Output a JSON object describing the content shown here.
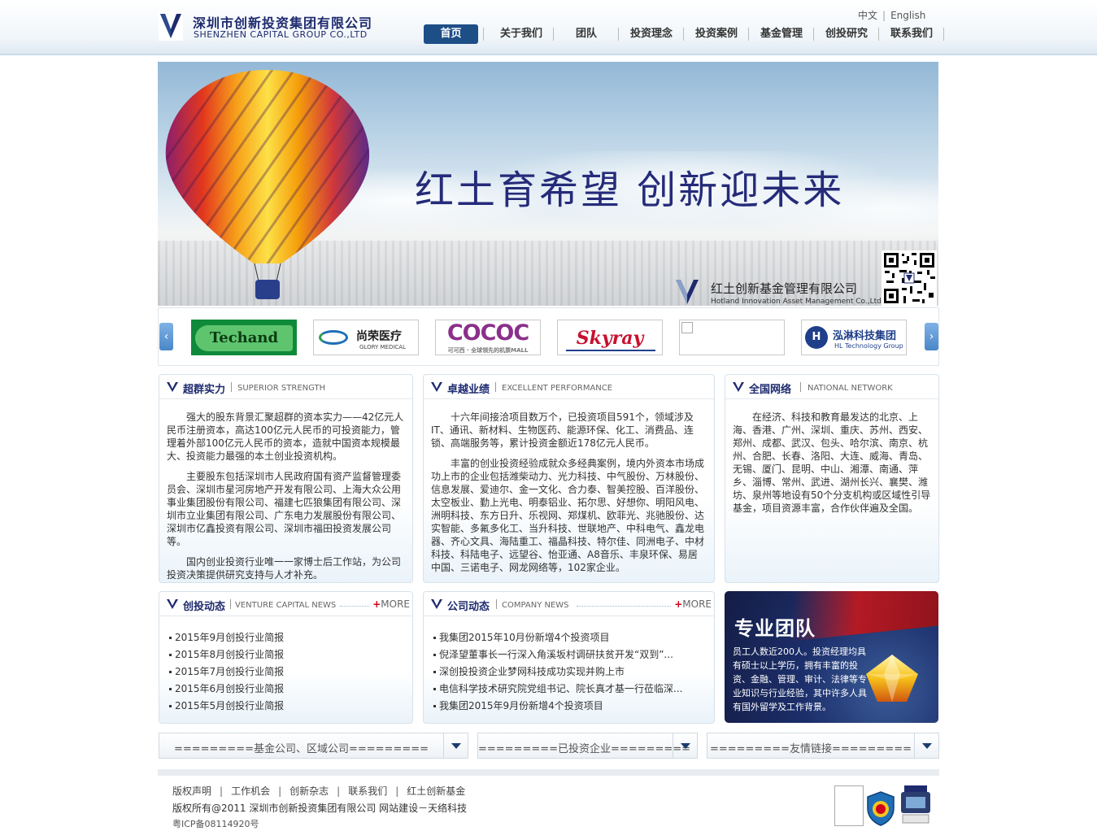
{
  "header": {
    "logo_cn": "深圳市创新投资集团有限公司",
    "logo_en": "SHENZHEN CAPITAL GROUP CO.,LTD",
    "lang_cn": "中文",
    "lang_sep": "|",
    "lang_en": "English",
    "nav": [
      "首页",
      "关于我们",
      "团队",
      "投资理念",
      "投资案例",
      "基金管理",
      "创投研究",
      "联系我们"
    ]
  },
  "banner": {
    "slogan": "红土育希望  创新迎未来",
    "fund_name": "红土创新基金管理有限公司",
    "fund_en": "Hotland Innovation Asset Management Co.,Ltd"
  },
  "partners": {
    "prev": "‹",
    "next": "›",
    "items": [
      {
        "name": "Techand",
        "text": "Techand"
      },
      {
        "name": "Glory Medical",
        "text": "尚荣医疗",
        "sub": "GLORY MEDICAL"
      },
      {
        "name": "COCOC",
        "text": "COCOC",
        "sub": "可可西 · 全球领先的机票MALL"
      },
      {
        "name": "Skyray",
        "text": "Skyray"
      },
      {
        "name": "empty",
        "text": ""
      },
      {
        "name": "HL Technology",
        "text": "泓淋科技集团",
        "sub": "HL Technology Group"
      }
    ]
  },
  "panels": {
    "strength": {
      "title": "超群实力",
      "en": "SUPERIOR STRENGTH",
      "paragraphs": [
        "强大的股东背景汇聚超群的资本实力——42亿元人民币注册资本，高达100亿元人民币的可投资能力，管理着外部100亿元人民币的资本，造就中国资本规模最大、投资能力最强的本土创业投资机构。",
        "主要股东包括深圳市人民政府国有资产监督管理委员会、深圳市星河房地产开发有限公司、上海大众公用事业集团股份有限公司、福建七匹狼集团有限公司、深圳市立业集团有限公司、广东电力发展股份有限公司、深圳市亿鑫投资有限公司、深圳市福田投资发展公司等。",
        "国内创业投资行业唯一一家博士后工作站，为公司投资决策提供研究支持与人才补充。"
      ]
    },
    "performance": {
      "title": "卓越业绩",
      "en": "EXCELLENT PERFORMANCE",
      "paragraphs": [
        "十六年间接洽项目数万个，已投资项目591个，领域涉及IT、通讯、新材料、生物医药、能源环保、化工、消费品、连锁、高端服务等，累计投资金额近178亿元人民币。",
        "丰富的创业投资经验成就众多经典案例，境内外资本市场成功上市的企业包括潍柴动力、光力科技、中气股份、万林股份、信息发展、爱迪尔、金一文化、合力泰、智美控股、百洋股份、太空板业、勤上光电、明泰铝业、拓尔思、好想你、明阳风电、洲明科技、东方日升、乐视网、郑煤机、欧菲光、兆驰股份、达实智能、多氟多化工、当升科技、世联地产、中科电气、鑫龙电器、齐心文具、海陆重工、福晶科技、特尔佳、同洲电子、中材科技、科陆电子、远望谷、怡亚通、A8音乐、丰泉环保、易居中国、三诺电子、网龙网络等，102家企业。"
      ]
    },
    "network": {
      "title": "全国网络",
      "en": "NATIONAL NETWORK",
      "paragraphs": [
        "在经济、科技和教育最发达的北京、上海、香港、广州、深圳、重庆、苏州、西安、郑州、成都、武汉、包头、哈尔滨、南京、杭州、合肥、长春、洛阳、大连、威海、青岛、无锡、厦门、昆明、中山、湘潭、南通、萍乡、淄博、常州、武进、湖州长兴、襄樊、潍坊、泉州等地设有50个分支机构或区域性引导基金，项目资源丰富，合作伙伴遍及全国。"
      ]
    },
    "vc_news": {
      "title": "创投动态",
      "en": "VENTURE CAPITAL NEWS",
      "more": "MORE",
      "items": [
        "2015年9月创投行业简报",
        "2015年8月创投行业简报",
        "2015年7月创投行业简报",
        "2015年6月创投行业简报",
        "2015年5月创投行业简报"
      ]
    },
    "company_news": {
      "title": "公司动态",
      "en": "COMPANY NEWS",
      "more": "MORE",
      "items": [
        "我集团2015年10月份新增4个投资项目",
        "倪泽望董事长一行深入角溪坂村调研扶贫开发“双到”...",
        "深创投投资企业梦网科技成功实现并购上市",
        "电信科学技术研究院党组书记、院长真才基一行莅临深...",
        "我集团2015年9月份新增4个投资项目"
      ]
    },
    "team": {
      "title": "专业团队",
      "text": "员工人数近200人。投资经理均具有硕士以上学历，拥有丰富的投资、金融、管理、审计、法律等专业知识与行业经验，其中许多人具有国外留学及工作背景。"
    }
  },
  "dropdowns": {
    "funds": "=========基金公司、区域公司=========",
    "invested": "=========已投资企业=========",
    "links": "=========友情链接========="
  },
  "footer": {
    "links": [
      "版权声明",
      "工作机会",
      "创新杂志",
      "联系我们",
      "红土创新基金"
    ],
    "sep": "|",
    "copyright": "版权所有@2011  深圳市创新投资集团有限公司  网站建设－天络科技",
    "icp": "粤ICP备08114920号"
  },
  "colors": {
    "brand": "#1d2a6e",
    "nav_active": "#1e4e86",
    "accent_red": "#d0021b"
  }
}
